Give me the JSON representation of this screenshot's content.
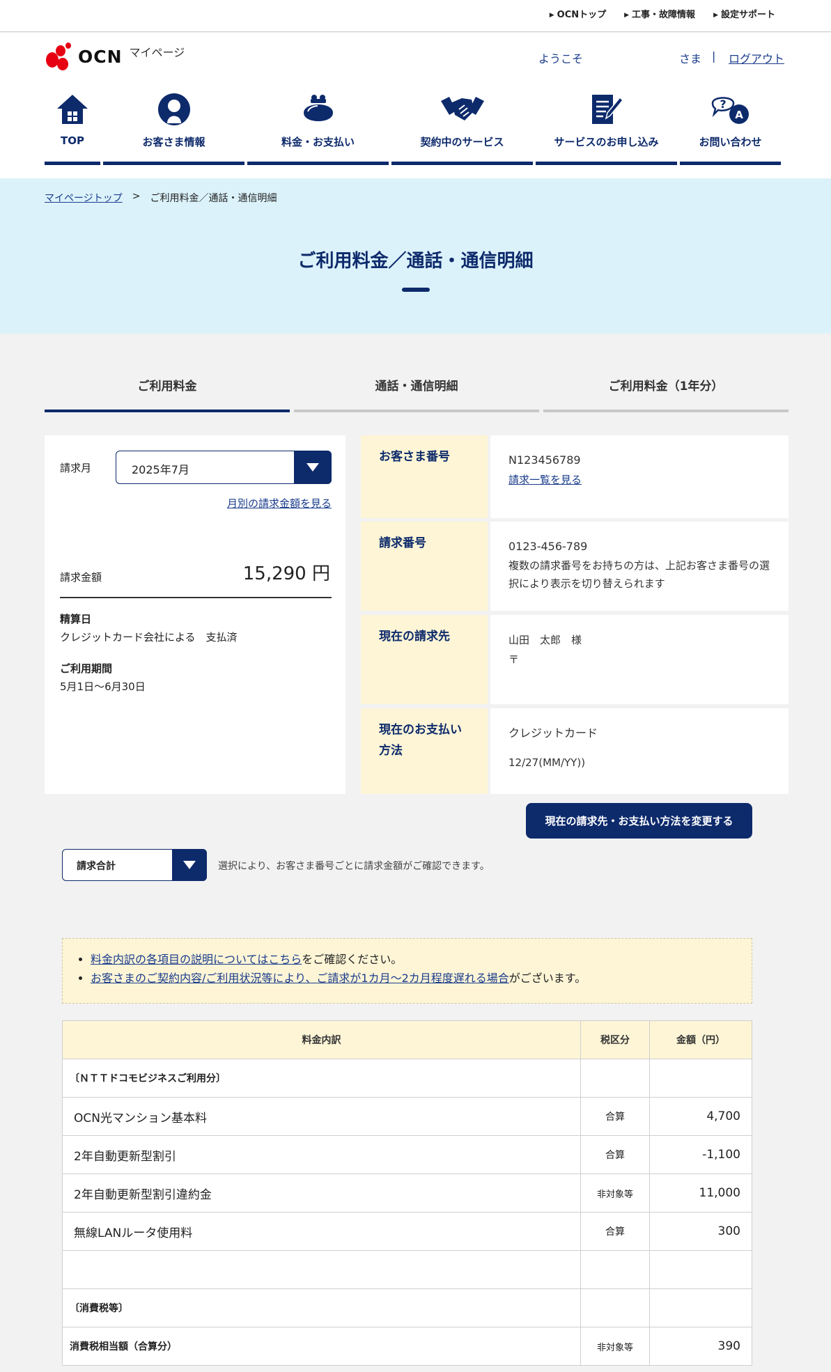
{
  "util_links": [
    "OCNトップ",
    "工事・故障情報",
    "設定サポート"
  ],
  "header": {
    "logo_text": "OCN",
    "logo_sub": "マイページ",
    "welcome": "ようこそ",
    "sama": "さま",
    "separator": "|",
    "logout": "ログアウト"
  },
  "gnav": [
    {
      "label": "TOP",
      "icon": "home-icon"
    },
    {
      "label": "お客さま情報",
      "icon": "user-icon"
    },
    {
      "label": "料金・お支払い",
      "icon": "purse-icon"
    },
    {
      "label": "契約中のサービス",
      "icon": "handshake-icon"
    },
    {
      "label": "サービスのお申し込み",
      "icon": "form-pen-icon"
    },
    {
      "label": "お問い合わせ",
      "icon": "question-chat-icon"
    }
  ],
  "breadcrumb": {
    "home": "マイページトップ",
    "sep": ">",
    "current": "ご利用料金／通話・通信明細"
  },
  "page_title": "ご利用料金／通話・通信明細",
  "tabs": [
    "ご利用料金",
    "通話・通信明細",
    "ご利用料金（1年分）"
  ],
  "billing": {
    "month_label": "請求月",
    "month_value": "2025年7月",
    "month_link": "月別の請求金額を見る",
    "amount_label": "請求金額",
    "amount_value": "15,290 円",
    "settle_label": "精算日",
    "settle_value": "クレジットカード会社による　支払済",
    "period_label": "ご利用期間",
    "period_value": "5月1日～6月30日"
  },
  "info": {
    "customer_no_label": "お客さま番号",
    "customer_no": "N123456789",
    "customer_no_link": "請求一覧を見る",
    "invoice_no_label": "請求番号",
    "invoice_no": "0123-456-789",
    "invoice_note": "複数の請求番号をお持ちの方は、上記お客さま番号の選択により表示を切り替えられます",
    "billing_to_label": "現在の請求先",
    "billing_to_name": "山田　太郎　様",
    "billing_to_zip": "〒",
    "payment_label": "現在のお支払い方法",
    "payment_method": "クレジットカード",
    "payment_exp": "12/27(MM/YY))"
  },
  "change_button": "現在の請求先・お支払い方法を変更する",
  "total_select": {
    "value": "請求合計",
    "note": "選択により、お客さま番号ごとに請求金額がご確認できます。"
  },
  "notice": [
    {
      "link": "料金内訳の各項目の説明についてはこちら",
      "rest": "をご確認ください。"
    },
    {
      "link": "お客さまのご契約内容/ご利用状況等により、ご請求が1カ月～2カ月程度遅れる場合",
      "rest": "がございます。"
    }
  ],
  "table": {
    "headers": [
      "料金内訳",
      "税区分",
      "金額（円）"
    ],
    "rows": [
      {
        "item": "〔ＮＴＴドコモビジネスご利用分〕",
        "tax": "",
        "amount": "",
        "small": true
      },
      {
        "item": "OCN光マンション基本料",
        "tax": "合算",
        "amount": "4,700",
        "small": false
      },
      {
        "item": "2年自動更新型割引",
        "tax": "合算",
        "amount": "-1,100",
        "small": false
      },
      {
        "item": "2年自動更新型割引違約金",
        "tax": "非対象等",
        "amount": "11,000",
        "small": false
      },
      {
        "item": "無線LANルータ使用料",
        "tax": "合算",
        "amount": "300",
        "small": false
      },
      {
        "item": "",
        "tax": "",
        "amount": "",
        "small": false
      },
      {
        "item": "〔消費税等〕",
        "tax": "",
        "amount": "",
        "small": true
      },
      {
        "item": "消費税相当額（合算分）",
        "tax": "非対象等",
        "amount": "390",
        "small": true
      }
    ]
  },
  "colors": {
    "navy": "#0d2a6b",
    "hero_bg": "#dbf2fa",
    "key_bg": "#fdf5d6",
    "logo_red": "#e60012"
  }
}
